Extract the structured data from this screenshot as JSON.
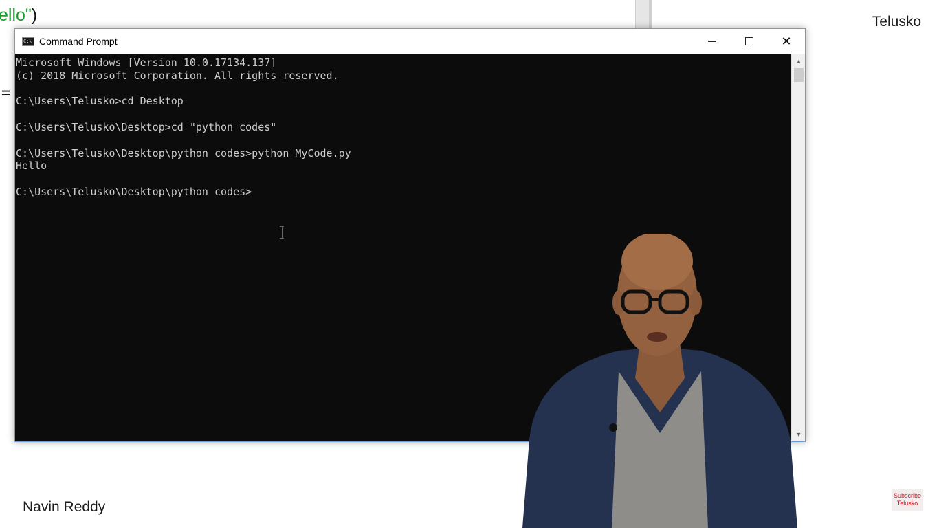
{
  "editor": {
    "code_fragment_string": "ello\"",
    "code_fragment_paren": ")",
    "equals_sign": "="
  },
  "overlay": {
    "brand": "Telusko",
    "presenter_name": "Navin Reddy",
    "subscribe_line1": "Subscribe",
    "subscribe_line2": "Telusko"
  },
  "window": {
    "title": "Command Prompt",
    "minimize_icon": "minimize-icon",
    "maximize_icon": "maximize-icon",
    "close_glyph": "✕"
  },
  "console": {
    "lines": [
      "Microsoft Windows [Version 10.0.17134.137]",
      "(c) 2018 Microsoft Corporation. All rights reserved.",
      "",
      "C:\\Users\\Telusko>cd Desktop",
      "",
      "C:\\Users\\Telusko\\Desktop>cd \"python codes\"",
      "",
      "C:\\Users\\Telusko\\Desktop\\python codes>python MyCode.py",
      "Hello",
      "",
      "C:\\Users\\Telusko\\Desktop\\python codes>"
    ]
  },
  "scrollbar": {
    "up_glyph": "▲",
    "down_glyph": "▼"
  },
  "colors": {
    "console_bg": "#0c0c0c",
    "console_text": "#cccccc",
    "window_border": "#6b9ad6",
    "string_green": "#1f9a2e",
    "subscribe_red": "#d3151f"
  }
}
